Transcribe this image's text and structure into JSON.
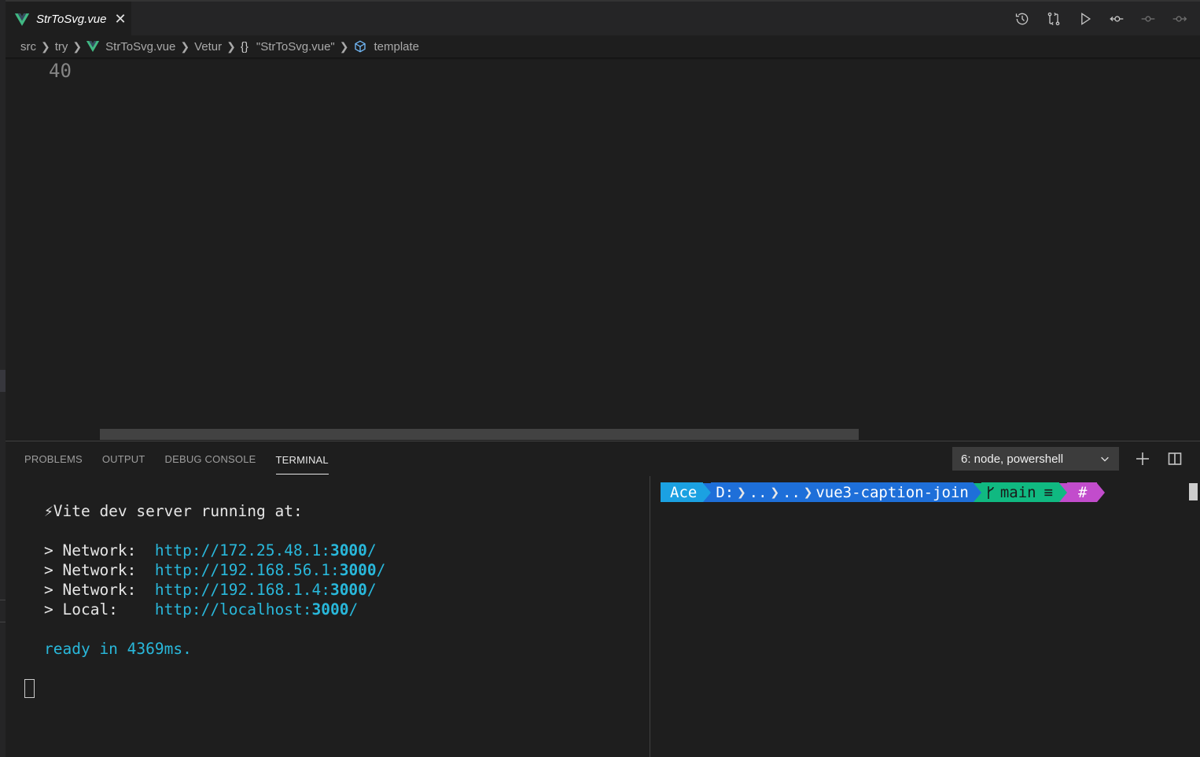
{
  "tab": {
    "title": "StrToSvg.vue",
    "close": "✕"
  },
  "toolbar": {
    "icons": [
      "history-icon",
      "compare-changes-icon",
      "run-icon",
      "git-commit-icon",
      "previous-change-icon",
      "next-change-icon"
    ]
  },
  "breadcrumb": {
    "items": [
      "src",
      "try",
      "StrToSvg.vue",
      "Vetur",
      "\"StrToSvg.vue\"",
      "template"
    ],
    "braces": "{}"
  },
  "editor": {
    "line_number": "40"
  },
  "panel": {
    "tabs": [
      "PROBLEMS",
      "OUTPUT",
      "DEBUG CONSOLE",
      "TERMINAL"
    ],
    "active_tab": "TERMINAL",
    "terminal_select": "6: node, powershell"
  },
  "terminal_left": {
    "heading": "⚡Vite dev server running at:",
    "rows": [
      {
        "label": "> Network:  ",
        "url_prefix": "http://172.25.48.1:",
        "port": "3000",
        "suffix": "/"
      },
      {
        "label": "> Network:  ",
        "url_prefix": "http://192.168.56.1:",
        "port": "3000",
        "suffix": "/"
      },
      {
        "label": "> Network:  ",
        "url_prefix": "http://192.168.1.4:",
        "port": "3000",
        "suffix": "/"
      },
      {
        "label": "> Local:    ",
        "url_prefix": "http://localhost:",
        "port": "3000",
        "suffix": "/"
      }
    ],
    "ready": "ready in 4369ms."
  },
  "terminal_right": {
    "user": "Ace",
    "drive": "D:",
    "dots1": "..",
    "dots2": "..",
    "folder": "vue3-caption-join",
    "branch": "main",
    "branch_status": "≡",
    "hash": "#"
  },
  "colors": {
    "accent_vue": "#41b883",
    "url": "#29b8db",
    "prompt_user": "#1ba1e2",
    "prompt_path": "#1e6fd9",
    "prompt_git": "#10b981",
    "prompt_hash": "#c24ccc"
  }
}
